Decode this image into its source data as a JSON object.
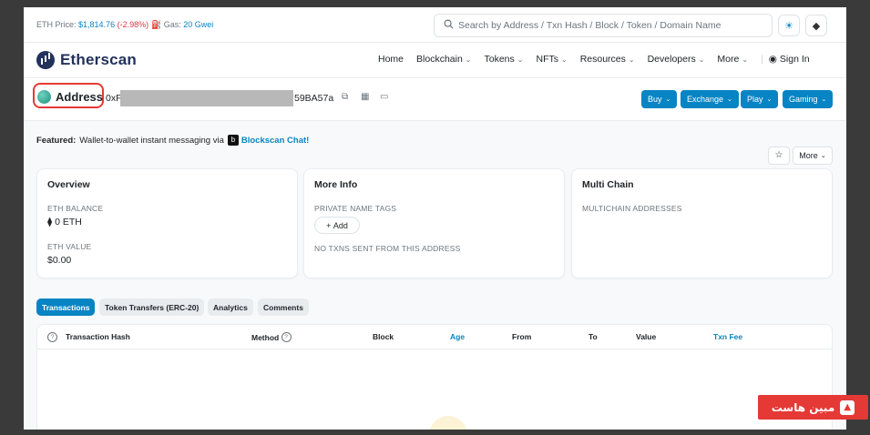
{
  "topbar": {
    "price_label": "ETH Price:",
    "price_value": "$1,814.76",
    "price_change": "(-2.98%)",
    "gas_label": "Gas:",
    "gas_value": "20 Gwei",
    "search_placeholder": "Search by Address / Txn Hash / Block / Token / Domain Name"
  },
  "header": {
    "logo_text": "Etherscan",
    "nav": [
      {
        "label": "Home"
      },
      {
        "label": "Blockchain"
      },
      {
        "label": "Tokens"
      },
      {
        "label": "NFTs"
      },
      {
        "label": "Resources"
      },
      {
        "label": "Developers"
      },
      {
        "label": "More"
      }
    ],
    "sign_in": "Sign In"
  },
  "address": {
    "label": "Address",
    "hash_prefix": "0xF",
    "hash_suffix": "59BA57a",
    "buttons": [
      "Buy",
      "Exchange",
      "Play",
      "Gaming"
    ]
  },
  "featured": {
    "label": "Featured:",
    "text": "Wallet-to-wallet instant messaging via",
    "badge": "b",
    "link": "Blockscan Chat!"
  },
  "actions": {
    "more_label": "More"
  },
  "cards": {
    "overview": {
      "title": "Overview",
      "eth_balance_label": "ETH BALANCE",
      "eth_balance_value": "0 ETH",
      "eth_value_label": "ETH VALUE",
      "eth_value_value": "$0.00"
    },
    "more_info": {
      "title": "More Info",
      "tags_label": "PRIVATE NAME TAGS",
      "add_label": "Add",
      "no_txns": "NO TXNS SENT FROM THIS ADDRESS"
    },
    "multi_chain": {
      "title": "Multi Chain",
      "label": "MULTICHAIN ADDRESSES"
    }
  },
  "tabs": [
    "Transactions",
    "Token Transfers (ERC-20)",
    "Analytics",
    "Comments"
  ],
  "table": {
    "columns": [
      "Transaction Hash",
      "Method",
      "Block",
      "Age",
      "From",
      "To",
      "Value",
      "Txn Fee"
    ]
  },
  "watermark": {
    "text": "مبین هاست"
  },
  "colors": {
    "accent": "#0784c3",
    "negative": "#dc3545",
    "highlight": "#e53935"
  }
}
